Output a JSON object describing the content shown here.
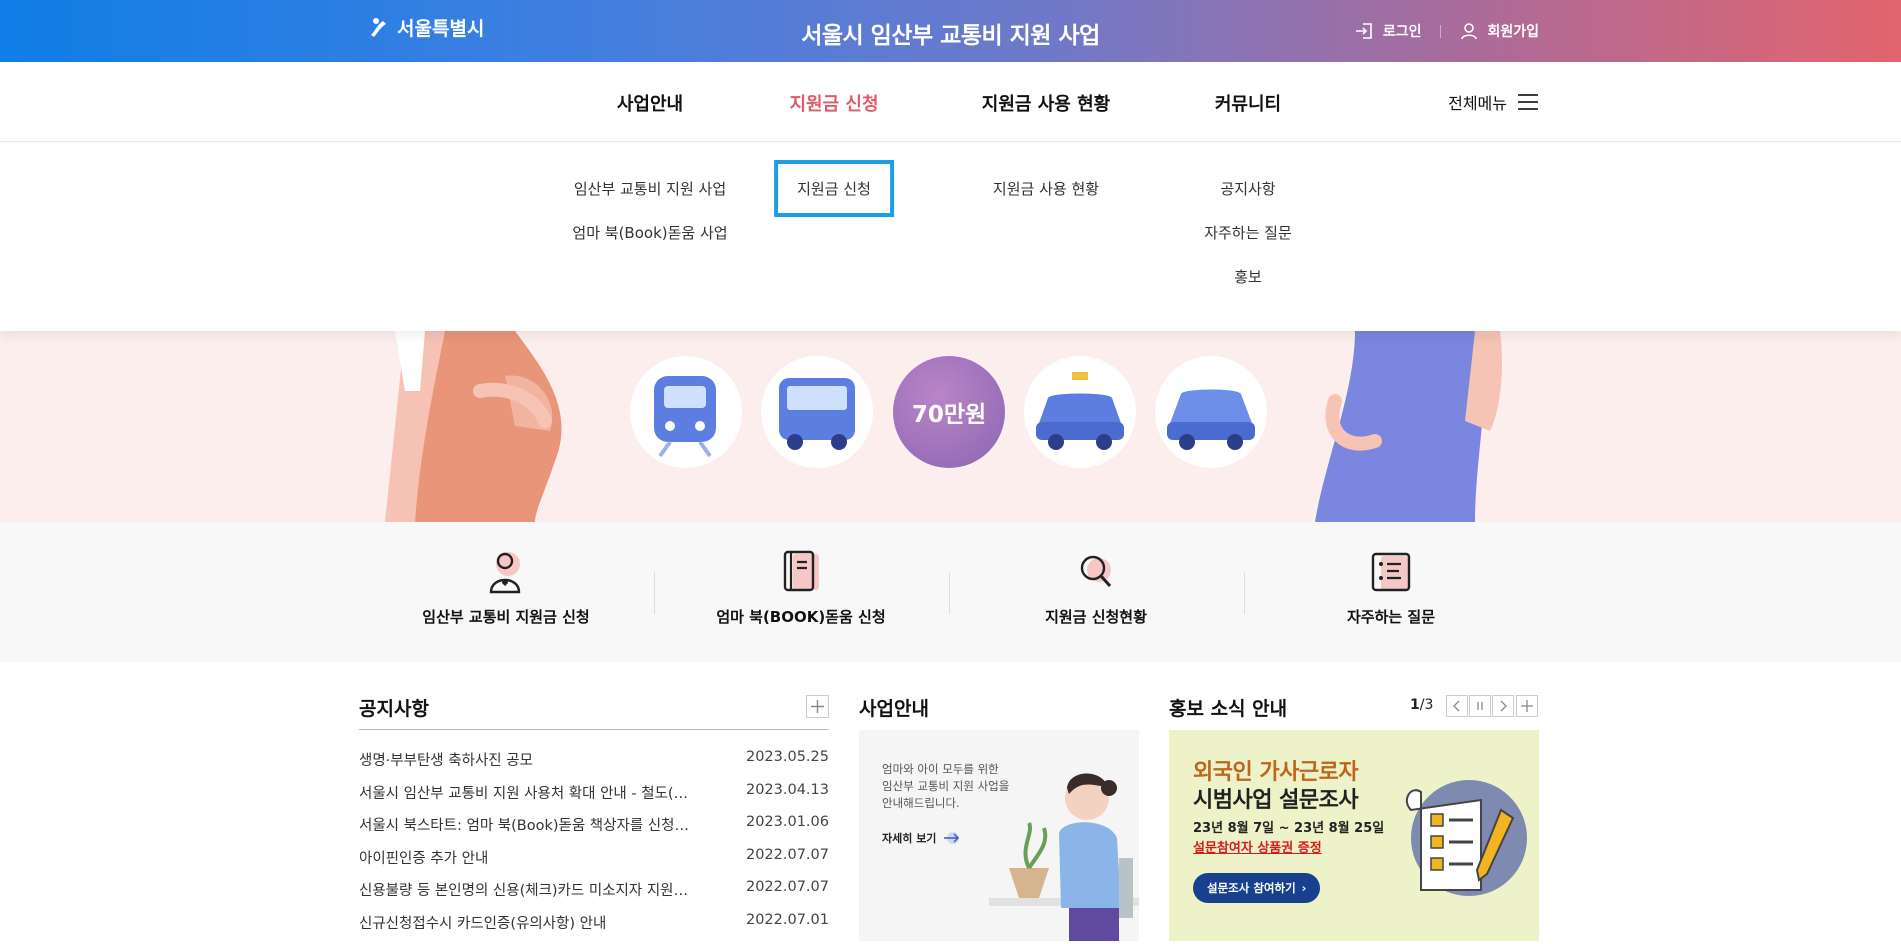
{
  "header": {
    "logo_text": "서울특별시",
    "site_title": "서울시 임산부 교통비 지원 사업",
    "login_label": "로그인",
    "signup_label": "회원가입"
  },
  "gnb": {
    "items": [
      "사업안내",
      "지원금 신청",
      "지원금 사용 현황",
      "커뮤니티"
    ],
    "active_index": 1,
    "active_color": "#e05a6a",
    "allmenu_label": "전체메뉴"
  },
  "dropdown": {
    "col1": [
      "임산부 교통비 지원 사업",
      "엄마 북(Book)돋움 사업"
    ],
    "col2": [
      "지원금 신청"
    ],
    "col3": [
      "지원금 사용 현황"
    ],
    "col4": [
      "공지사항",
      "자주하는 질문",
      "홍보"
    ],
    "highlight_color": "#1c9ee6"
  },
  "hero": {
    "amount_label": "70만원"
  },
  "quick_menu": [
    {
      "label": "임산부 교통비 지원금 신청",
      "icon": "pregnant-person-icon"
    },
    {
      "label": "엄마 북(BOOK)돋움 신청",
      "icon": "book-icon"
    },
    {
      "label": "지원금 신청현황",
      "icon": "magnifier-icon"
    },
    {
      "label": "자주하는 질문",
      "icon": "faq-list-icon"
    }
  ],
  "notice": {
    "title": "공지사항",
    "rows": [
      {
        "title": "생명·부부탄생 축하사진 공모",
        "date": "2023.05.25"
      },
      {
        "title": "서울시 임산부 교통비 지원 사용처 확대 안내 - 철도(…",
        "date": "2023.04.13"
      },
      {
        "title": "서울시 북스타트: 엄마 북(Book)돋움 책상자를 신청…",
        "date": "2023.01.06"
      },
      {
        "title": "아이핀인증 추가 안내",
        "date": "2022.07.07"
      },
      {
        "title": "신용불량 등 본인명의 신용(체크)카드 미소지자 지원…",
        "date": "2022.07.07"
      },
      {
        "title": "신규신청접수시 카드인증(유의사항) 안내",
        "date": "2022.07.01"
      }
    ]
  },
  "business": {
    "title": "사업안내",
    "lines": [
      "엄마와 아이 모두를 위한",
      "임산부 교통비 지원 사업을",
      "안내해드립니다."
    ],
    "more_label": "자세히 보기"
  },
  "promo": {
    "title": "홍보 소식 안내",
    "page_current": "1",
    "page_total": "/3",
    "headline1": "외국인 가사근로자",
    "headline2": "시범사업 설문조사",
    "period": "23년 8월 7일 ~ 23년 8월 25일",
    "gift": "설문참여자 상품권 증정",
    "button_label": "설문조사 참여하기"
  }
}
